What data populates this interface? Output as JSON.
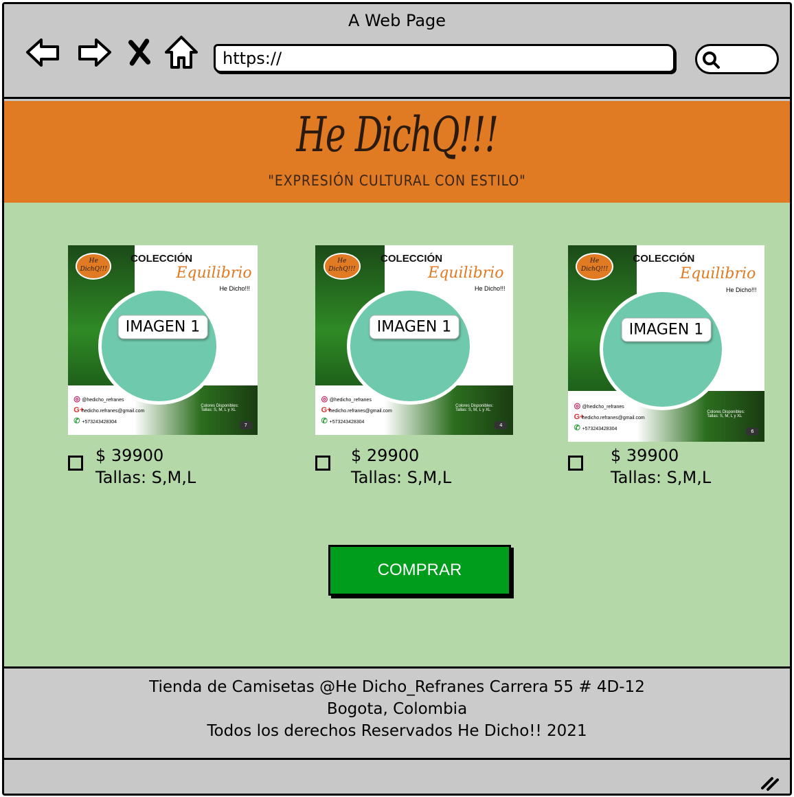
{
  "window": {
    "title": "A Web Page"
  },
  "toolbar": {
    "url": "https://",
    "icons": [
      "back-arrow-icon",
      "forward-arrow-icon",
      "close-x-icon",
      "home-icon",
      "search-icon"
    ]
  },
  "banner": {
    "logo": "He DichQ!!!",
    "tagline": "\"EXPRESIÓN CULTURAL CON ESTILO\"",
    "color": "#e07a23"
  },
  "products": [
    {
      "image_label": "IMAGEN 1",
      "collection": "COLECCIÓN",
      "collection_name": "Equilibrio",
      "brand": "He Dicho!!!",
      "badge": "He DichQ!!!",
      "social": [
        "@hedicho_refranes",
        "hedicho.refranes@gmail.com",
        "+573243428304"
      ],
      "colors_note": "Colores Disponibles:",
      "sizes_note": "Tallas: S, M, L y XL",
      "page": "7",
      "price": "$ 39900",
      "sizes": "Tallas: S,M,L"
    },
    {
      "image_label": "IMAGEN 1",
      "collection": "COLECCIÓN",
      "collection_name": "Equilibrio",
      "brand": "He Dicho!!!",
      "badge": "He DichQ!!!",
      "social": [
        "@hedicho_refranes",
        "hedicho.refranes@gmail.com",
        "+573243428304"
      ],
      "colors_note": "Colores Disponibles:",
      "sizes_note": "Tallas: S, M, L y XL",
      "page": "4",
      "price": "$ 29900",
      "sizes": "Tallas: S,M,L"
    },
    {
      "image_label": "IMAGEN 1",
      "collection": "COLECCIÓN",
      "collection_name": "Equilibrio",
      "brand": "He Dicho!!!",
      "badge": "He DichQ!!!",
      "social": [
        "@hedicho_refranes",
        "hedicho.refranes@gmail.com",
        "+573243428304"
      ],
      "colors_note": "Colores Disponibles:",
      "sizes_note": "Tallas: S, M, L y XL",
      "page": "6",
      "price": "$ 39900",
      "sizes": "Tallas: S,M,L"
    }
  ],
  "buy_button": {
    "label": "COMPRAR",
    "color": "#009d1c"
  },
  "footer": {
    "line1": "Tienda de Camisetas @He Dicho_Refranes Carrera 55 # 4D-12",
    "line2": "Bogota, Colombia",
    "line3": "Todos los derechos Reservados  He Dicho!! 2021"
  },
  "colors": {
    "content_bg": "#b5d8a9",
    "chrome": "#c8c8c8"
  }
}
